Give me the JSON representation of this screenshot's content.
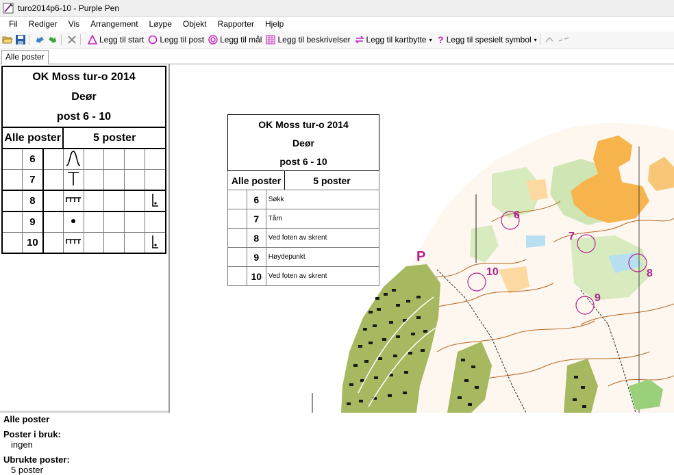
{
  "window": {
    "title": "turo2014p6-10 - Purple Pen"
  },
  "menu": [
    "Fil",
    "Rediger",
    "Vis",
    "Arrangement",
    "Løype",
    "Objekt",
    "Rapporter",
    "Hjelp"
  ],
  "toolbar": {
    "add_start": "Legg til start",
    "add_control": "Legg til post",
    "add_finish": "Legg til mål",
    "add_descriptions": "Legg til beskrivelser",
    "add_map_exchange": "Legg til kartbytte",
    "add_special": "Legg til spesielt symbol"
  },
  "tabs": [
    "Alle poster"
  ],
  "description_sheet": {
    "event": "OK Moss tur-o 2014",
    "course_line": "Deør",
    "subtitle": "post 6 - 10",
    "course_name": "Alle poster",
    "course_count": "5 poster",
    "rows": [
      {
        "num": "6",
        "feature_icon": "re-entrant-symbol",
        "feature_text": "Søkk",
        "detail_icon": ""
      },
      {
        "num": "7",
        "feature_icon": "dam-symbol",
        "feature_text": "Tårn",
        "detail_icon": ""
      },
      {
        "num": "8",
        "feature_icon": "cliff-symbol",
        "feature_text": "Ved foten av skrent",
        "detail_icon": "foot-position-symbol"
      },
      {
        "num": "9",
        "feature_icon": "knoll-symbol",
        "feature_text": "Høydepunkt",
        "detail_icon": ""
      },
      {
        "num": "10",
        "feature_icon": "cliff-symbol",
        "feature_text": "Ved foten av skrent",
        "detail_icon": "foot-position-symbol"
      }
    ]
  },
  "info": {
    "heading": "Alle poster",
    "used_label": "Poster i bruk:",
    "used_value": "ingen",
    "unused_label": "Ubrukte poster:",
    "unused_value": "5 poster"
  },
  "map": {
    "parking_label": "P",
    "control_labels": [
      "6",
      "7",
      "8",
      "9",
      "10"
    ],
    "colors": {
      "purple": "#b0228f",
      "forest": "#a6b860",
      "open": "#f7b44c",
      "green": "#9ad07a"
    }
  }
}
